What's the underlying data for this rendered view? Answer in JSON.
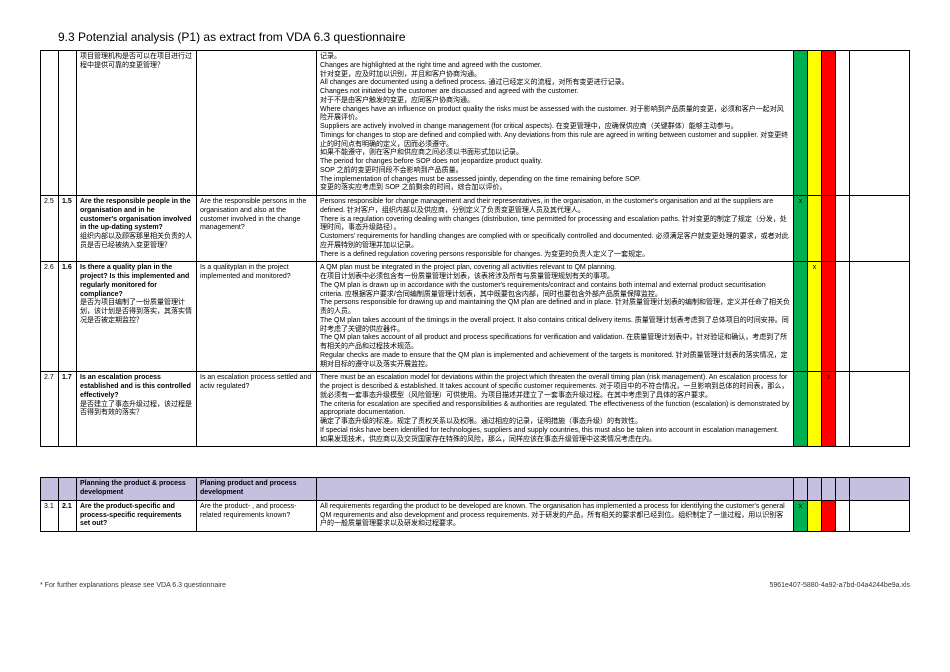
{
  "title": "9.3 Potenzial analysis (P1) as extract from VDA 6.3 questionnaire",
  "rows": [
    {
      "n1": "",
      "n2": "",
      "q_en": "",
      "q_cn": "项目管理机构是否可以在项目进行过程中提供可靠的变更管理？",
      "r_en": "",
      "r_cn": "",
      "expl": "记录。\nChanges are highlighted at the right time and agreed with the customer.\n针对变更，应及时加以识别，并且和客户协商沟通。\nAll changes are documented using a defined process. 通过已经定义的流程，对所有变更进行记录。\nChanges not initiated by the customer are discussed and agreed with the customer.\n对于不是由客户触发的变更，应同客户协商沟通。\nWhere changes have an influence on product quality the risks must be assessed with the customer. 对于影响到产品质量的变更，必须和客户一起对风险开展评价。\nSuppliers are actively involved in change management (for critical aspects). 在变更管理中，应确保供应商（关键群体）能够主动参与。\nTimings for changes to stop are defined and complied with. Any deviations from this rule are agreed in writing between customer and supplier. 对变更终止的时间点有明确的定义，因而必须遵守。\n如果不能遵守，则在客户和供应商之间必须以书面形式加以记录。\nThe period for changes before SOP does not jeopardize product quality.\nSOP 之前的变更时间段不会影响到产品质量。\nThe implementation of changes must be assessed jointly, depending on the time remaining before SOP.\n变更的落实应考虑到 SOP 之前剩余的时间，综合加以评价。",
      "marks": [
        "",
        "",
        "",
        ""
      ],
      "partial": true
    },
    {
      "n1": "2.5",
      "n2": "1.5",
      "q_en": "Are the responsible people in the organisation and in he customer's organisation involved in the up-dating system?",
      "q_cn": "组织内部以及顾客那里相关负责的人员是否已经被纳入变更管理？",
      "r_en": "Are the responsible persons in the organisation and also at the customer involved in the change management?",
      "r_cn": "",
      "expl": "Persons responsible for change management and their representatives, in the organisation, in the customer's organisation and at the suppliers are defined. 针对客户，组织内部以及供应商，分别定义了负责变更管理人员及其代理人。\nThere is a regulation covering dealing with changes (distribution, time permitted for processing and escalation paths. 针对变更的制定了规定（分发，处理时间，事态升级路径）。\nCustomers' requirements for handling changes are complied with or specifically controlled and documented. 必须满足客户就变更处理的要求，或者对此应开展特别的管理并加以记录。\nThere is a defined regulation covering persons responsible for changes.  为变更的负责人定义了一套规定。",
      "marks": [
        "x",
        "",
        "",
        ""
      ]
    },
    {
      "n1": "2.6",
      "n2": "1.6",
      "q_en": "Is there a quality plan in the project?         Is this implemented and regularly monitored for compliance?",
      "q_cn": "是否为项目编制了一份质量管理计划，该计划是否得到落实，其落实情况是否被定期监控？",
      "r_en": "Is a qualityplan in the project implemented and monitored?",
      "r_cn": "",
      "expl": "A QM plan must be integrated in the project plan, covering all activities relevant to QM planning.\n在项目计划表中必须包含有一份质量管理计划表，该表将涉及所有与质量管理规划有关的事项。\nThe QM plan is drawn up in accordance with the customer's requirements/contract and contains both internal and external product securitisation criteria. 应根据客户要求/合同编制质量管理计划表，其中既要包含内部，同时也要包含外部产品质量保障监控。\nThe persons responsible for drawing up and maintaining the QM plan are defined and in place. 针对质量管理计划表的编制和管理，定义并任命了相关负责的人员。\nThe QM plan takes account of the timings in the overall project. It also contains critical delivery items. 质量管理计划表考虑到了总体项目的时间安排。同时考虑了关键的供应器件。\nThe QM plan takes account of all product and process specifications for verification and validation. 在质量管理计划表中，针对验证和确认，考虑到了所有相关的产品和过程技术规范。\nRegular checks are made to ensure that the QM plan is implemented and achievement of the targets is monitored. 针对质量管理计划表的落实情况，定期对目标的遵守以及落实开展监控。",
      "marks": [
        "",
        "x",
        "",
        ""
      ]
    },
    {
      "n1": "2.7",
      "n2": "1.7",
      "q_en": "Is an escalation process established and is this controlled effectively?",
      "q_cn": "是否建立了事态升级过程，该过程是否得到有效的落实？",
      "r_en": "Is an escalation process settled and activ regulated?",
      "r_cn": "",
      "expl": "There must be an escalation model for deviations within the project which threaten the overall timing plan (risk management). An escalation process for the project is described & established. It takes account of specific customer requirements. 对于项目中的不符合情况，一旦影响到总体的时间表，那么，就必须有一套事态升级模型（风险管理）可供使用。为项目描述并建立了一套事态升级过程。在其中考虑到了具体的客户要求。\nThe criteria for escalation are specified and responsibilities & authorities are regulated. The effectiveness of the function (escalation) is demonstrated by appropriate documentation.\n确定了事态升级的标准。规定了责权关系以及权限。通过相应的记录，证明措施（事态升级）的有效性。\nIf special risks have been identified for technologies, suppliers and supply countries, this must also be taken into account in escalation management.\n如果发现技术，供应商以及交货国家存在特殊的风险，那么，同样应该在事态升级管理中这类情况考虑在内。",
      "marks": [
        "",
        "",
        "x",
        ""
      ]
    }
  ],
  "section": {
    "head_en": "Planning the product & process development",
    "head_r": "Planing product and process development"
  },
  "rows2": [
    {
      "n1": "3.1",
      "n2": "2.1",
      "q_en": "Are the product-specific and process-specific requirements set out?",
      "r_en": "Are the product- , and process-related requirements known?",
      "expl": "All requirements regarding the product to be developed are known. The organisation has implemented a process for identifying the customer's general QM requirements and also development and process requirements. 对于研发的产品，所有相关的要求都已经到位。组织制定了一道过程，用以识别客户的一般质量管理要求以及研发和过程要求。",
      "marks": [
        "x",
        "",
        "",
        ""
      ]
    }
  ],
  "footer_left": "* For further explanations please see  VDA 6.3 questionnaire",
  "footer_right": "5961e407-5880-4a92-a7bd-04a4244be9a.xls"
}
